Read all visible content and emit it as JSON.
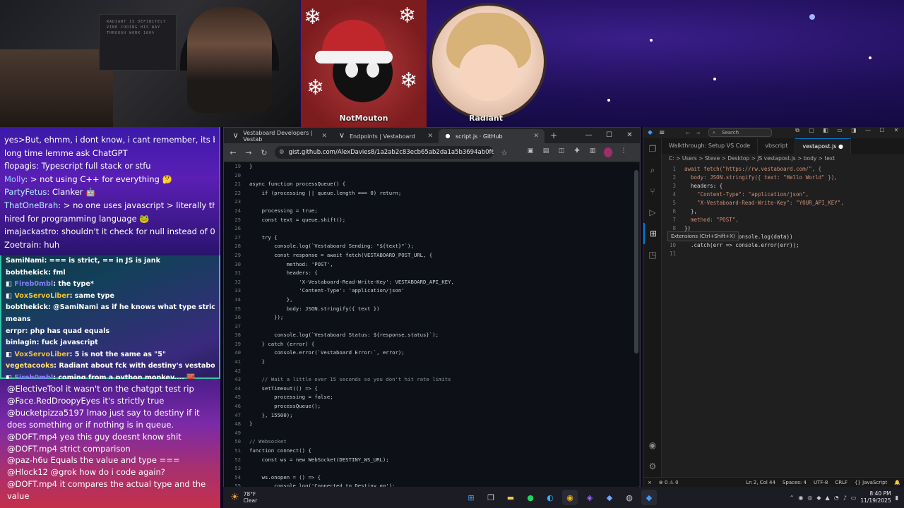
{
  "stream": {
    "panels": [
      {
        "label": "NotMouton"
      },
      {
        "label": "Radiant"
      }
    ],
    "poster_text": "RADIANT IS DEFINITELY VIBE CODING HIS WAY THROUGH WORK 100%"
  },
  "chat_top": [
    {
      "user": "",
      "text": "yes>But, ehmm, i dont know, i cant remember, its been a",
      "color": "#ffffff"
    },
    {
      "user": "",
      "text": "long time lemme ask ChatGPT",
      "color": "#ffffff"
    },
    {
      "user": "flopagis",
      "text": ": Typescript full stack or stfu",
      "color": "#ffffff"
    },
    {
      "user": "Molly",
      "text": ": > not using C++ for everything 🤔",
      "color": "#8fd6ff"
    },
    {
      "user": "PartyFetus",
      "text": ": Clanker 🤖",
      "color": "#b0f0ff"
    },
    {
      "user": "ThatOneBrah",
      "text": ": > no one uses javascript > literally the mos",
      "color": "#b0f0ff"
    },
    {
      "user": "",
      "text": "hired for programming language 🐸",
      "color": "#ffffff"
    },
    {
      "user": "imajackastro",
      "text": ": shouldn't it check for null instead of 0",
      "color": "#ffffff"
    },
    {
      "user": "Zoetrain",
      "text": ": huh",
      "color": "#ffffff"
    }
  ],
  "chat_mid": [
    {
      "user": "SamiNami",
      "text": ": === is strict, == in JS is jank",
      "color": "#ffffff"
    },
    {
      "user": "bobthekick",
      "text": ": fml",
      "color": "#ffffff"
    },
    {
      "user": "Fireb0mbl",
      "text": ": the type*",
      "color": "#8a7cff"
    },
    {
      "user": "VoxServoLiber",
      "text": ": same type",
      "color": "#f3c23a"
    },
    {
      "user": "bobthekick",
      "text": ": @SamiNami as if he knows what type strict even",
      "color": "#ffffff"
    },
    {
      "user": "",
      "text": "means",
      "color": "#ffffff"
    },
    {
      "user": "errpr",
      "text": ": php has quad equals",
      "color": "#ffffff"
    },
    {
      "user": "binlagin",
      "text": ": fuck javascript",
      "color": "#ffffff"
    },
    {
      "user": "VoxServoLiber",
      "text": ": 5 is not the same as \"5\"",
      "color": "#f3c23a"
    },
    {
      "user": "vegetacooks",
      "text": ": Radiant about fck with destiny's vestaboard",
      "color": "#ffe07a"
    },
    {
      "user": "Fireb0mbl",
      "text": ": coming from a python monkey.... 🧱",
      "color": "#8a7cff"
    }
  ],
  "chat_bottom": [
    {
      "user": "@ElectiveTool",
      "text": " it wasn't on the chatgpt test rip"
    },
    {
      "user": "@Face.RedDroopyEyes",
      "text": " it's strictly true"
    },
    {
      "user": "@bucketpizza5197",
      "text": " lmao just say to destiny if it does something or if nothing is in queue."
    },
    {
      "user": "@DOFT.mp4",
      "text": " yea this guy doesnt know shit"
    },
    {
      "user": "@DOFT.mp4",
      "text": " strict comparison"
    },
    {
      "user": "@paz-h6u",
      "text": " Equals the value and type ==="
    },
    {
      "user": "@Hlock12",
      "text": " @grok how do i code again?"
    },
    {
      "user": "@DOFT.mp4",
      "text": " it compares the actual type and the value"
    }
  ],
  "browser": {
    "tabs": [
      {
        "label": "Vestaboard Developers | Vestab",
        "icon": "V"
      },
      {
        "label": "Endpoints | Vestaboard",
        "icon": "V"
      },
      {
        "label": "script.js · GitHub",
        "icon": "●"
      }
    ],
    "url": "gist.github.com/AlexDavies8/1a2ab2c83ecb65ab2da1a5b3694ab0f6",
    "code": [
      {
        "n": "19",
        "t": "}"
      },
      {
        "n": "20",
        "t": ""
      },
      {
        "n": "21",
        "t": "async function processQueue() {"
      },
      {
        "n": "22",
        "t": "    if (processing || queue.length === 0) return;"
      },
      {
        "n": "23",
        "t": ""
      },
      {
        "n": "24",
        "t": "    processing = true;"
      },
      {
        "n": "25",
        "t": "    const text = queue.shift();"
      },
      {
        "n": "26",
        "t": ""
      },
      {
        "n": "27",
        "t": "    try {"
      },
      {
        "n": "28",
        "t": "        console.log(`Vestaboard Sending: \"${text}\"`);"
      },
      {
        "n": "29",
        "t": "        const response = await fetch(VESTABOARD_POST_URL, {"
      },
      {
        "n": "30",
        "t": "            method: 'POST',"
      },
      {
        "n": "31",
        "t": "            headers: {"
      },
      {
        "n": "32",
        "t": "                'X-Vestaboard-Read-Write-Key': VESTABOARD_API_KEY,"
      },
      {
        "n": "33",
        "t": "                'Content-Type': 'application/json'"
      },
      {
        "n": "34",
        "t": "            },"
      },
      {
        "n": "35",
        "t": "            body: JSON.stringify({ text })"
      },
      {
        "n": "36",
        "t": "        });"
      },
      {
        "n": "37",
        "t": ""
      },
      {
        "n": "38",
        "t": "        console.log(`Vestaboard Status: ${response.status}`);"
      },
      {
        "n": "39",
        "t": "    } catch (error) {"
      },
      {
        "n": "40",
        "t": "        console.error(`Vestaboard Error:`, error);"
      },
      {
        "n": "41",
        "t": "    }"
      },
      {
        "n": "42",
        "t": ""
      },
      {
        "n": "43",
        "t": "    // Wait a little over 15 seconds so you don't hit rate limits"
      },
      {
        "n": "44",
        "t": "    setTimeout(() => {"
      },
      {
        "n": "45",
        "t": "        processing = false;"
      },
      {
        "n": "46",
        "t": "        processQueue();"
      },
      {
        "n": "47",
        "t": "    }, 15500);"
      },
      {
        "n": "48",
        "t": "}"
      },
      {
        "n": "49",
        "t": ""
      },
      {
        "n": "50",
        "t": "// Websocket"
      },
      {
        "n": "51",
        "t": "function connect() {"
      },
      {
        "n": "52",
        "t": "    const ws = new WebSocket(DESTINY_WS_URL);"
      },
      {
        "n": "53",
        "t": ""
      },
      {
        "n": "54",
        "t": "    ws.onopen = () => {"
      },
      {
        "n": "55",
        "t": "        console.log('Connected to Destiny.gg');"
      }
    ]
  },
  "vscode": {
    "search_placeholder": "Search",
    "tabs": [
      {
        "label": "Walkthrough: Setup VS Code"
      },
      {
        "label": "vbscript"
      },
      {
        "label": "vestapost.js"
      }
    ],
    "breadcrumb": "C: > Users > Steve > Desktop > JS vestapost.js > body > text",
    "tooltip": "Extensions (Ctrl+Shift+X)",
    "code": [
      {
        "n": "1",
        "t": "await fetch(\"https://rw.vestaboard.com/\", {"
      },
      {
        "n": "2",
        "t": "  body: JSON.stringify({ text: \"Hello World\" }),"
      },
      {
        "n": "3",
        "t": "  headers: {"
      },
      {
        "n": "4",
        "t": "    \"Content-Type\": \"application/json\","
      },
      {
        "n": "5",
        "t": "    \"X-Vestaboard-Read-Write-Key\": \"YOUR_API_KEY\","
      },
      {
        "n": "6",
        "t": "  },"
      },
      {
        "n": "7",
        "t": "  method: \"POST\","
      },
      {
        "n": "8",
        "t": "})"
      },
      {
        "n": "9",
        "t": "  .then(data => console.log(data))"
      },
      {
        "n": "10",
        "t": "  .catch(err => console.error(err));"
      },
      {
        "n": "11",
        "t": ""
      }
    ],
    "status": {
      "errors": "⊗ 0 ⚠ 0",
      "position": "Ln 2, Col 44",
      "spaces": "Spaces: 4",
      "encoding": "UTF-8",
      "eol": "CRLF",
      "language": "{} JavaScript"
    }
  },
  "taskbar": {
    "temp": "78°F",
    "condition": "Clear",
    "time": "8:40 PM",
    "date": "11/19/2025"
  }
}
